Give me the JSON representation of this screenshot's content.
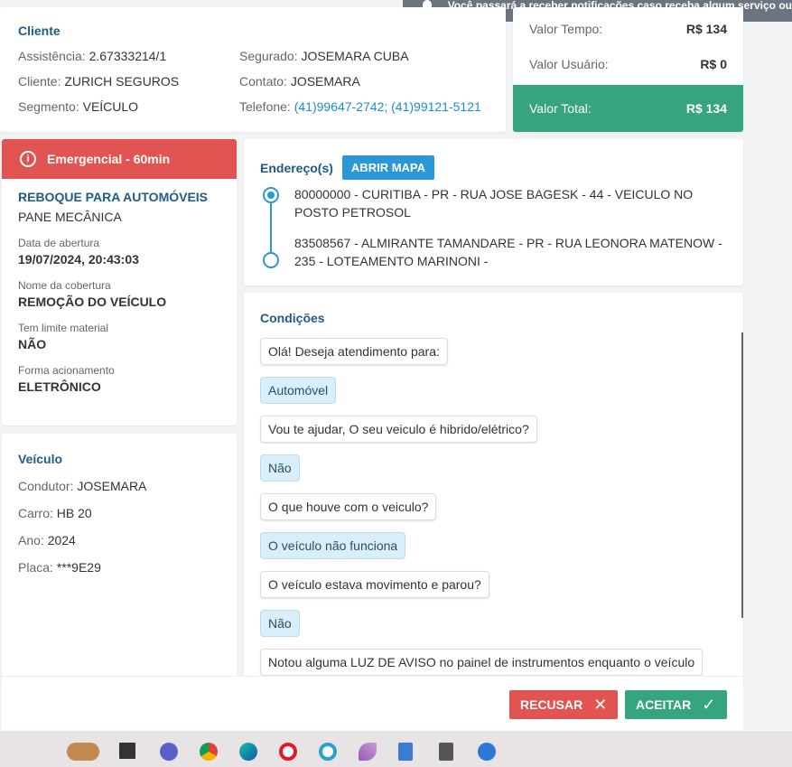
{
  "toast": {
    "text": "Você passará a receber notificações caso receba algum serviço ou"
  },
  "client": {
    "title": "Cliente",
    "assistencia_label": "Assistência:",
    "assistencia": "2.67333214/1",
    "segurado_label": "Segurado:",
    "segurado": "JOSEMARA CUBA",
    "cliente_label": "Cliente:",
    "cliente": "ZURICH SEGUROS",
    "contato_label": "Contato:",
    "contato": "JOSEMARA",
    "segmento_label": "Segmento:",
    "segmento": "VEÍCULO",
    "telefone_label": "Telefone:",
    "telefone": "(41)99647-2742; (41)99121-5121"
  },
  "values": {
    "tempo_label": "Valor Tempo:",
    "tempo": "R$ 134",
    "usuario_label": "Valor Usuário:",
    "usuario": "R$ 0",
    "total_label": "Valor Total:",
    "total": "R$ 134",
    "total_color": "#36a57d"
  },
  "service": {
    "priority": "Emergencial - 60min",
    "priority_color": "#e15451",
    "type": "REBOQUE PARA AUTOMÓVEIS",
    "subtype": "PANE MECÂNICA",
    "opened_label": "Data de abertura",
    "opened": "19/07/2024, 20:43:03",
    "coverage_label": "Nome da cobertura",
    "coverage": "REMOÇÃO DO VEÍCULO",
    "limit_label": "Tem limite material",
    "limit": "NÃO",
    "trigger_label": "Forma acionamento",
    "trigger": "ELETRÔNICO"
  },
  "vehicle": {
    "title": "Veículo",
    "driver_label": "Condutor:",
    "driver": "JOSEMARA",
    "car_label": "Carro:",
    "car": "HB 20",
    "year_label": "Ano:",
    "year": "2024",
    "plate_label": "Placa:",
    "plate": "***9E29"
  },
  "address": {
    "title": "Endereço(s)",
    "map_button": "ABRIR MAPA",
    "origin": "80000000 - CURITIBA - PR - RUA JOSE BAGESK - 44 - VEICULO NO POSTO PETROSOL",
    "destination": "83508567 - ALMIRANTE TAMANDARE - PR - RUA LEONORA MATENOW - 235 - LOTEAMENTO MARINONI -"
  },
  "conditions": {
    "title": "Condições",
    "messages": [
      {
        "role": "question",
        "text": "Olá! Deseja atendimento para:"
      },
      {
        "role": "answer",
        "text": "Automóvel"
      },
      {
        "role": "question",
        "text": "Vou te ajudar, O seu veiculo é hibrido/elétrico?"
      },
      {
        "role": "answer",
        "text": "Não"
      },
      {
        "role": "question",
        "text": "O que houve com o veiculo?"
      },
      {
        "role": "answer",
        "text": "O veículo não funciona"
      },
      {
        "role": "question",
        "text": "O veículo estava movimento e parou?"
      },
      {
        "role": "answer",
        "text": "Não"
      },
      {
        "role": "question",
        "text": "Notou alguma LUZ DE AVISO no painel de instrumentos enquanto o veículo"
      }
    ]
  },
  "footer": {
    "reject": "RECUSAR",
    "reject_icon": "close-icon",
    "accept": "ACEITAR",
    "accept_icon": "check-icon"
  },
  "taskbar": {
    "icons": [
      "widgets-icon",
      "desktop-icon",
      "teams-icon",
      "chrome-icon",
      "edge-icon",
      "opera-icon",
      "app-icon",
      "feather-icon",
      "notepad-icon",
      "calculator-icon",
      "browser-icon"
    ]
  }
}
